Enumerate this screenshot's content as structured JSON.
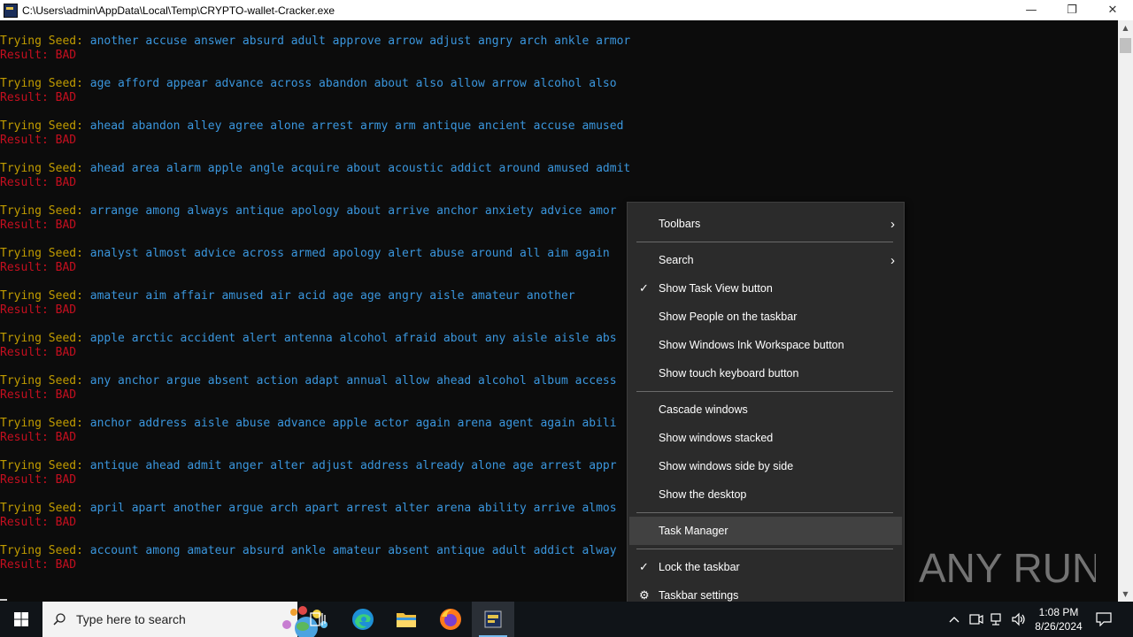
{
  "window": {
    "title": "C:\\Users\\admin\\AppData\\Local\\Temp\\CRYPTO-wallet-Cracker.exe",
    "minimize": "—",
    "restore": "❐",
    "close": "✕"
  },
  "console": {
    "prefix": "Trying Seed: ",
    "result": "Result: BAD",
    "seeds": [
      "another accuse answer absurd adult approve arrow adjust angry arch ankle armor",
      "age afford appear advance across abandon about also allow arrow alcohol also",
      "ahead abandon alley agree alone arrest army arm antique ancient accuse amused",
      "ahead area alarm apple angle acquire about acoustic addict around amused admit",
      "arrange among always antique apology about arrive anchor anxiety advice amor",
      "analyst almost advice across armed apology alert abuse around all aim again",
      "amateur aim affair amused air acid age age angry aisle amateur another",
      "apple arctic accident alert antenna alcohol afraid about any aisle aisle abs",
      "any anchor argue absent action adapt annual allow ahead alcohol album access",
      "anchor address aisle abuse advance apple actor again arena agent again abili",
      "antique ahead admit anger alter adjust address already alone age arrest appr",
      "april apart another argue arch apart arrest alter arena ability arrive almos",
      "account among amateur absurd ankle amateur absent antique adult addict alway"
    ]
  },
  "context_menu": {
    "items": [
      {
        "label": "Toolbars",
        "submenu": true
      },
      {
        "label": "Search",
        "submenu": true
      },
      {
        "label": "Show Task View button",
        "checked": true
      },
      {
        "label": "Show People on the taskbar"
      },
      {
        "label": "Show Windows Ink Workspace button"
      },
      {
        "label": "Show touch keyboard button"
      },
      {
        "label": "Cascade windows"
      },
      {
        "label": "Show windows stacked"
      },
      {
        "label": "Show windows side by side"
      },
      {
        "label": "Show the desktop"
      },
      {
        "label": "Task Manager",
        "highlighted": true
      },
      {
        "label": "Lock the taskbar",
        "checked": true
      },
      {
        "label": "Taskbar settings",
        "icon": "gear-icon"
      }
    ]
  },
  "taskbar": {
    "search_placeholder": "Type here to search",
    "clock_time": "1:08 PM",
    "clock_date": "8/26/2024",
    "icons": [
      "windows-start-icon",
      "search-icon",
      "task-view-icon",
      "edge-icon",
      "file-explorer-icon",
      "firefox-icon",
      "crypto-cracker-app-icon"
    ],
    "tray_icons": [
      "chevron-up-icon",
      "meet-now-icon",
      "network-icon",
      "volume-icon",
      "notifications-icon"
    ]
  },
  "watermark": {
    "text": "ANY RUN"
  },
  "colors": {
    "console_bg": "#0c0c0c",
    "prefix": "#c19c00",
    "seed": "#3a96dd",
    "result": "#c50f1f",
    "menu_bg": "#2b2b2b",
    "taskbar_bg": "#101418"
  }
}
